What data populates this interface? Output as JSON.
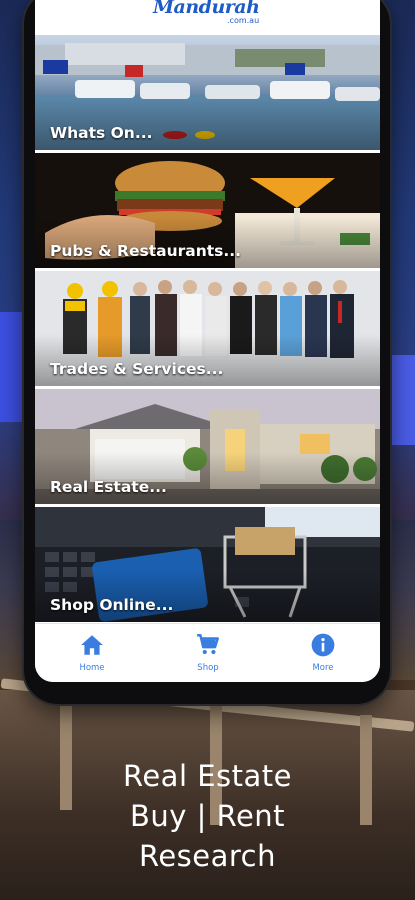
{
  "app": {
    "logo_text": "Mandurah",
    "logo_subtext": ".com.au"
  },
  "tiles": [
    {
      "label": "Whats On..."
    },
    {
      "label": "Pubs & Restaurants..."
    },
    {
      "label": "Trades & Services..."
    },
    {
      "label": "Real Estate..."
    },
    {
      "label": "Shop Online..."
    }
  ],
  "tabbar": {
    "items": [
      {
        "label": "Home",
        "icon": "home-icon"
      },
      {
        "label": "Shop",
        "icon": "cart-icon"
      },
      {
        "label": "More",
        "icon": "info-icon"
      }
    ]
  },
  "promo": {
    "lines": [
      "Real Estate",
      "Buy | Rent",
      "Research"
    ]
  },
  "colors": {
    "accent": "#3a7de0",
    "logo": "#1f5bc6"
  }
}
